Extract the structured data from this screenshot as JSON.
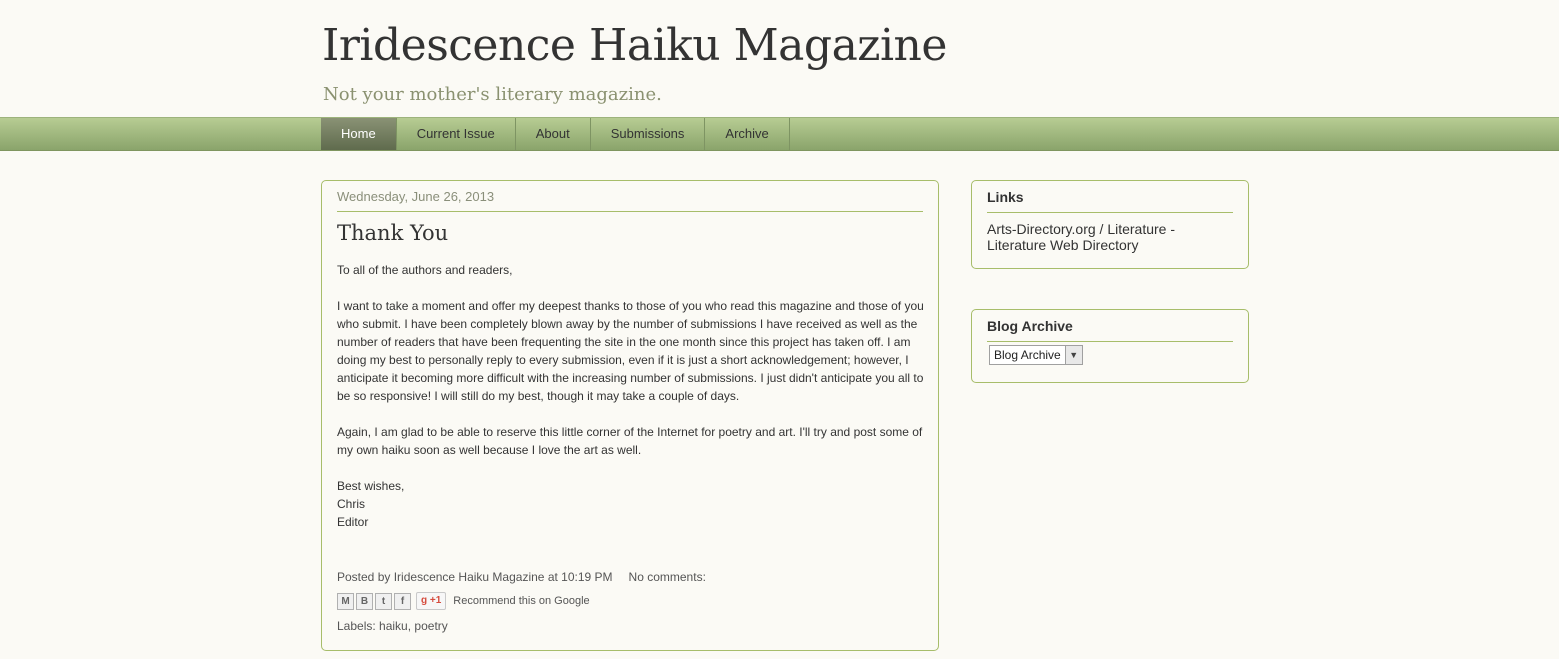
{
  "header": {
    "title": "Iridescence Haiku Magazine",
    "description": "Not your mother's literary magazine."
  },
  "nav": {
    "tabs": [
      {
        "label": "Home",
        "active": true
      },
      {
        "label": "Current Issue"
      },
      {
        "label": "About"
      },
      {
        "label": "Submissions"
      },
      {
        "label": "Archive"
      }
    ]
  },
  "post": {
    "date": "Wednesday, June 26, 2013",
    "title": "Thank You",
    "paragraphs": [
      "To all of the authors and readers,",
      "I want to take a moment and offer my deepest thanks to those of you who read this magazine and those of you who submit. I have been completely blown away by the number of submissions I have received as well as the number of readers that have been frequenting the site in the one month since this project has taken off. I am doing my best to personally reply to every submission, even if it is just a short acknowledgement; however, I anticipate it becoming more difficult with the increasing number of submissions. I just didn't anticipate you all to be so responsive! I will still do my best, though it may take a couple of days.",
      "Again, I am glad to be able to reserve this little corner of the Internet for poetry and art. I'll try and post some of my own haiku soon as well because I love the art as well."
    ],
    "signoff": [
      "Best wishes,",
      "Chris",
      "Editor"
    ],
    "footer": {
      "posted_by_prefix": "Posted by",
      "author": "Iridescence Haiku Magazine",
      "at": "at",
      "time": "10:19 PM",
      "comments": "No comments:",
      "share_icons": [
        "email-icon",
        "blogger-icon",
        "twitter-icon",
        "facebook-icon"
      ],
      "plusone": "+1",
      "recommend": "Recommend this on Google",
      "labels_prefix": "Labels:",
      "labels": [
        "haiku",
        "poetry"
      ]
    }
  },
  "sidebar": {
    "links": {
      "title": "Links",
      "items": [
        "Arts-Directory.org / Literature - Literature Web Directory"
      ]
    },
    "archive": {
      "title": "Blog Archive",
      "select_value": "Blog Archive"
    }
  },
  "colors": {
    "accent_border": "#a7bd6a",
    "nav_green": "#9db37c",
    "background": "#fbfaf5"
  }
}
